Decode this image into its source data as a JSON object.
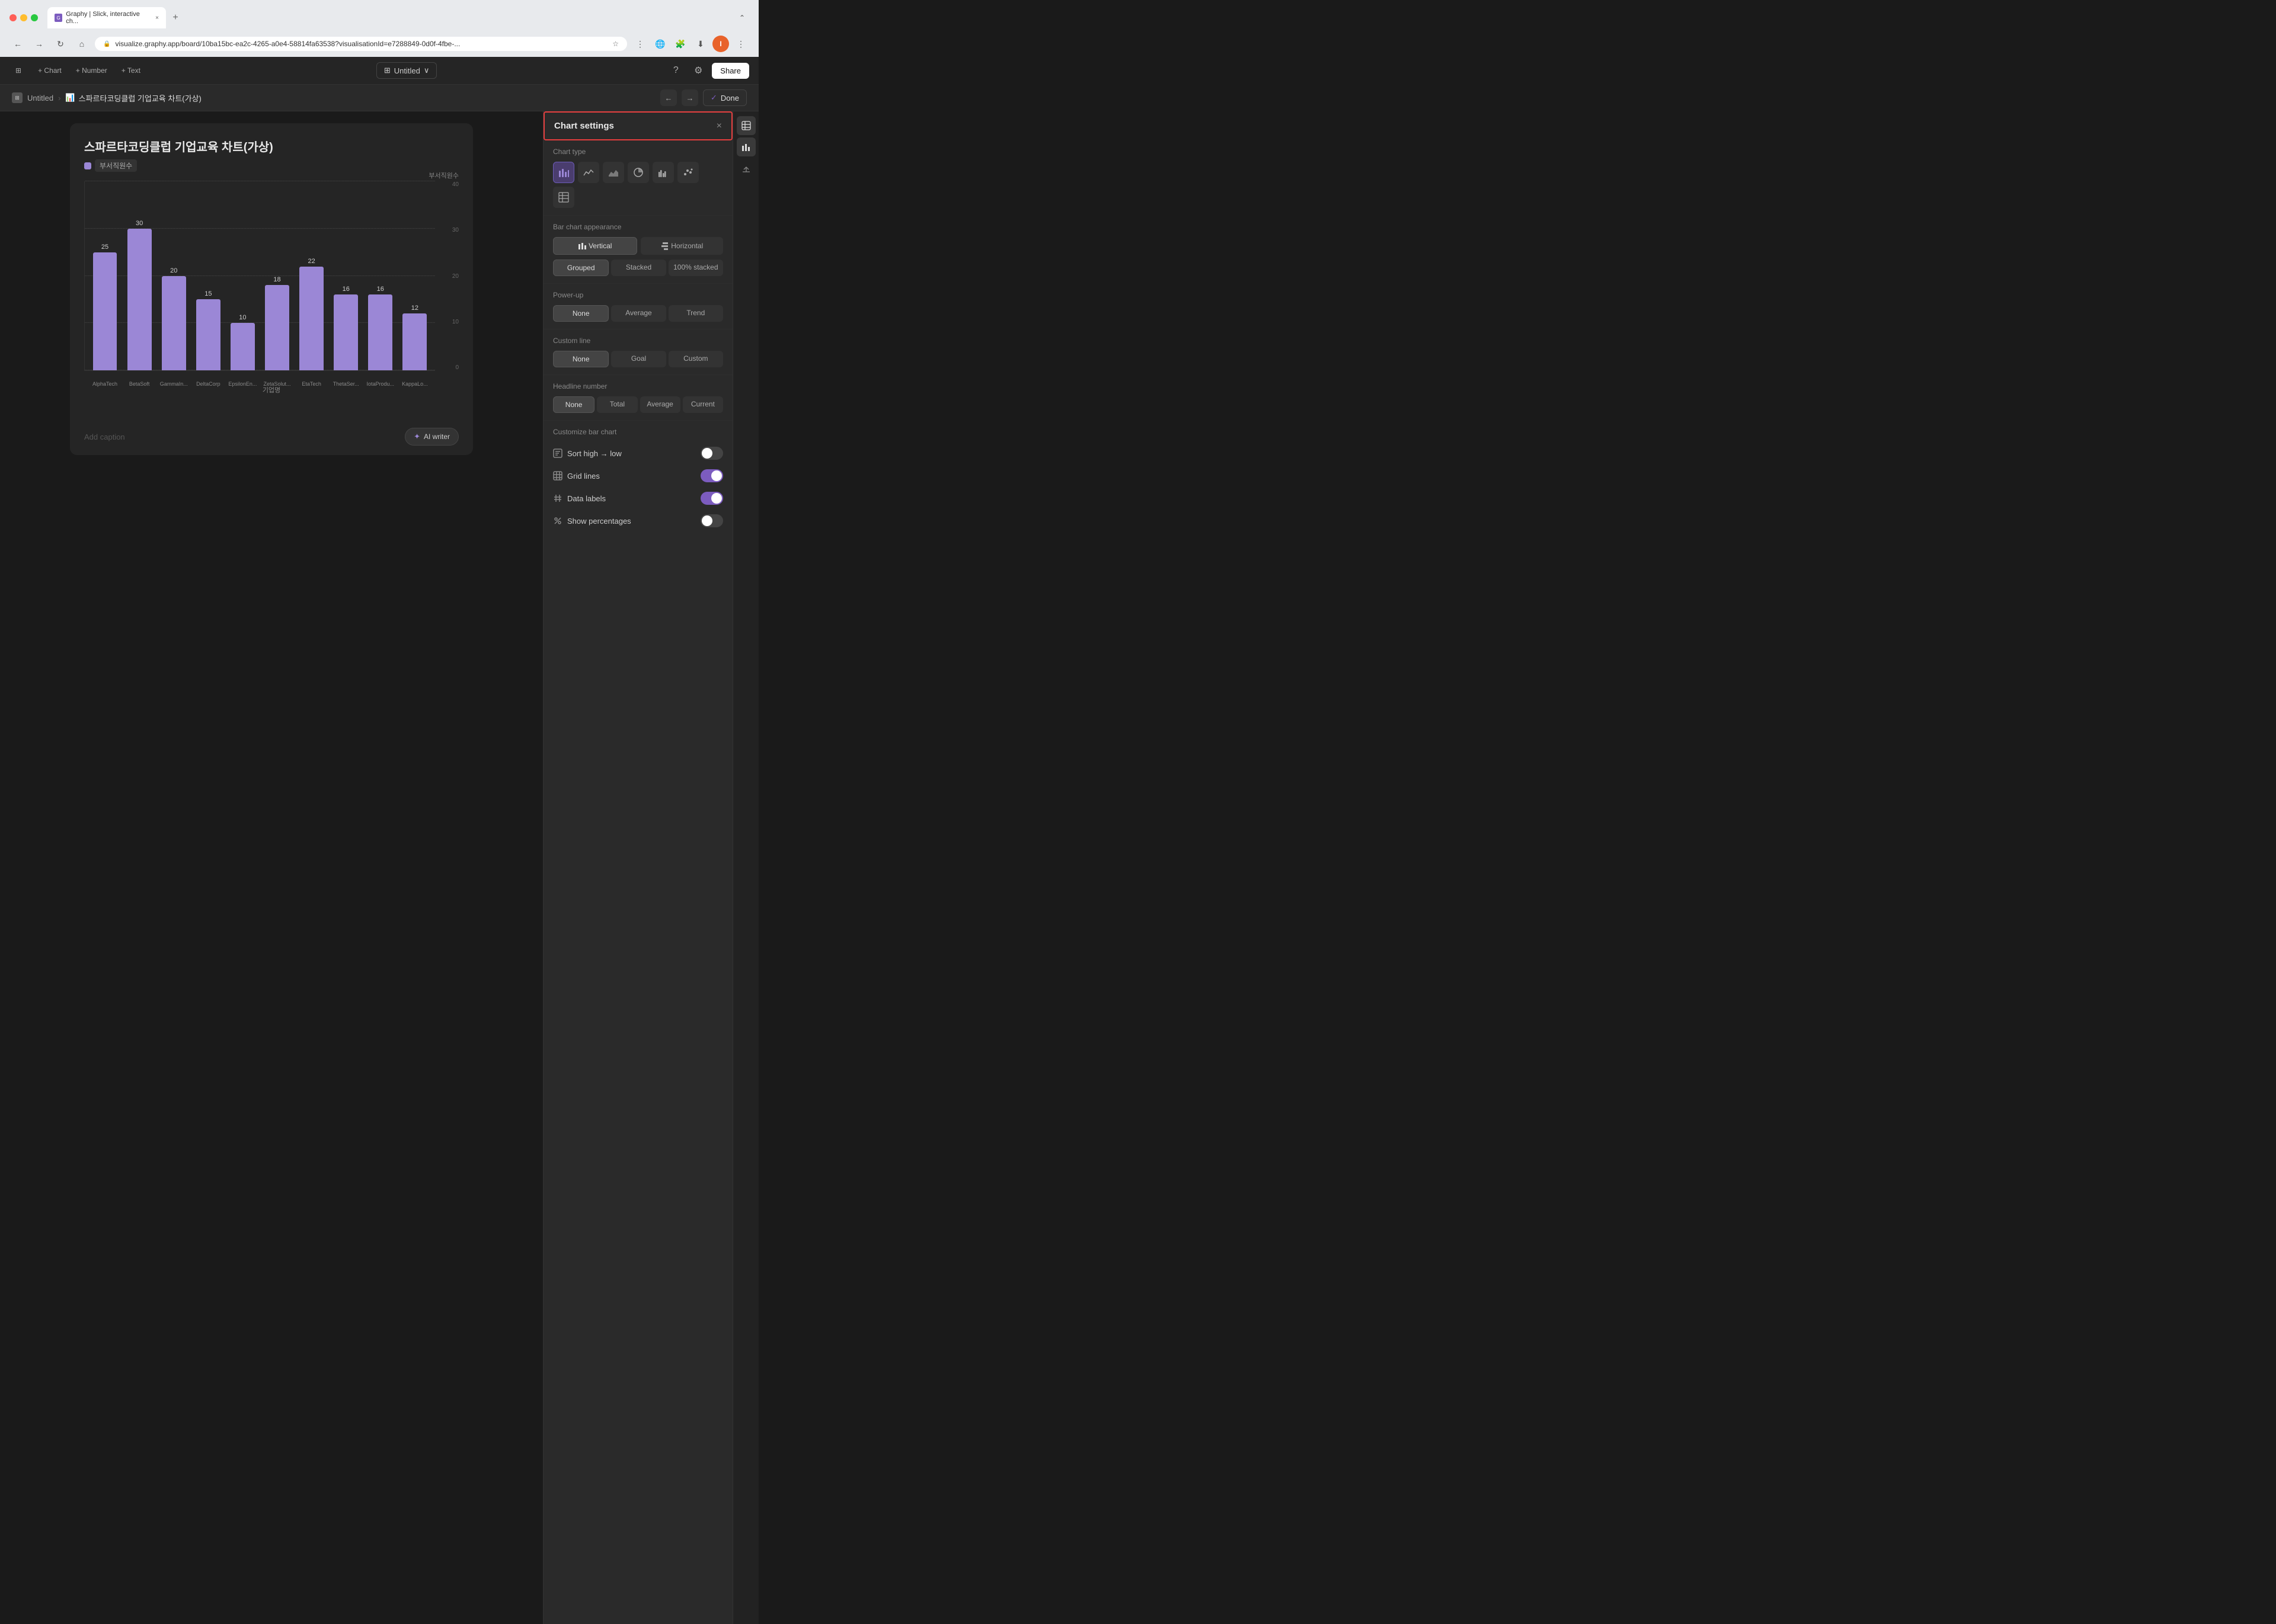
{
  "browser": {
    "tab_title": "Graphy | Slick, interactive ch...",
    "url": "visualize.graphy.app/board/10ba15bc-ea2c-4265-a0e4-58814fa63538?visualisationId=e7288849-0d0f-4fbe-...",
    "expand_label": "⌃"
  },
  "toolbar": {
    "chart_label": "+ Chart",
    "number_label": "+ Number",
    "text_label": "+ Text",
    "doc_title": "Untitled",
    "share_label": "Share"
  },
  "breadcrumb": {
    "parent": "Untitled",
    "current": "스파르타코딩클럽 기업교육 차트(가상)",
    "done_label": "Done"
  },
  "chart": {
    "title": "스파르타코딩클럽 기업교육 차트(가상)",
    "legend_label": "부서직원수",
    "y_axis_label": "부서직원수",
    "x_axis_label": "기업명",
    "bars": [
      {
        "label": "AlphaTech",
        "value": 25,
        "height_pct": 62
      },
      {
        "label": "BetaSoft",
        "value": 30,
        "height_pct": 75
      },
      {
        "label": "GammaIn...",
        "value": 20,
        "height_pct": 50
      },
      {
        "label": "DeltaCorp",
        "value": 15,
        "height_pct": 37
      },
      {
        "label": "EpsilonEn...",
        "value": 10,
        "height_pct": 25
      },
      {
        "label": "ZetaSolut...",
        "value": 18,
        "height_pct": 45
      },
      {
        "label": "EtaTech",
        "value": 22,
        "height_pct": 55
      },
      {
        "label": "ThetaSer...",
        "value": 16,
        "height_pct": 40
      },
      {
        "label": "IotaProdu...",
        "value": 16,
        "height_pct": 40
      },
      {
        "label": "KappaLo...",
        "value": 12,
        "height_pct": 30
      }
    ],
    "y_max": 40,
    "y_ticks": [
      40,
      30,
      20,
      10,
      0
    ]
  },
  "settings": {
    "title": "Chart settings",
    "close_label": "×",
    "chart_type_label": "Chart type",
    "chart_types": [
      {
        "name": "bar",
        "icon": "bar"
      },
      {
        "name": "line",
        "icon": "line"
      },
      {
        "name": "area",
        "icon": "area"
      },
      {
        "name": "pie",
        "icon": "pie"
      },
      {
        "name": "grouped-bar",
        "icon": "grouped-bar"
      },
      {
        "name": "scatter",
        "icon": "scatter"
      },
      {
        "name": "table",
        "icon": "table"
      }
    ],
    "appearance_label": "Bar chart appearance",
    "vertical_label": "Vertical",
    "horizontal_label": "Horizontal",
    "grouped_label": "Grouped",
    "stacked_label": "Stacked",
    "stacked100_label": "100% stacked",
    "powerup_label": "Power-up",
    "powerup_none": "None",
    "powerup_average": "Average",
    "powerup_trend": "Trend",
    "custom_line_label": "Custom line",
    "customline_none": "None",
    "customline_goal": "Goal",
    "customline_custom": "Custom",
    "headline_label": "Headline number",
    "headline_none": "None",
    "headline_total": "Total",
    "headline_average": "Average",
    "headline_current": "Current",
    "customize_label": "Customize bar chart",
    "sort_label": "Sort high → low",
    "sort_on": false,
    "gridlines_label": "Grid lines",
    "gridlines_on": true,
    "datalabels_label": "Data labels",
    "datalabels_on": true,
    "showpct_label": "Show percentages",
    "showpct_on": false
  },
  "caption": {
    "placeholder": "Add caption",
    "ai_writer_label": "AI writer"
  },
  "icons_panel": {
    "items": [
      "table-icon",
      "bar-chart-icon",
      "export-icon"
    ]
  }
}
